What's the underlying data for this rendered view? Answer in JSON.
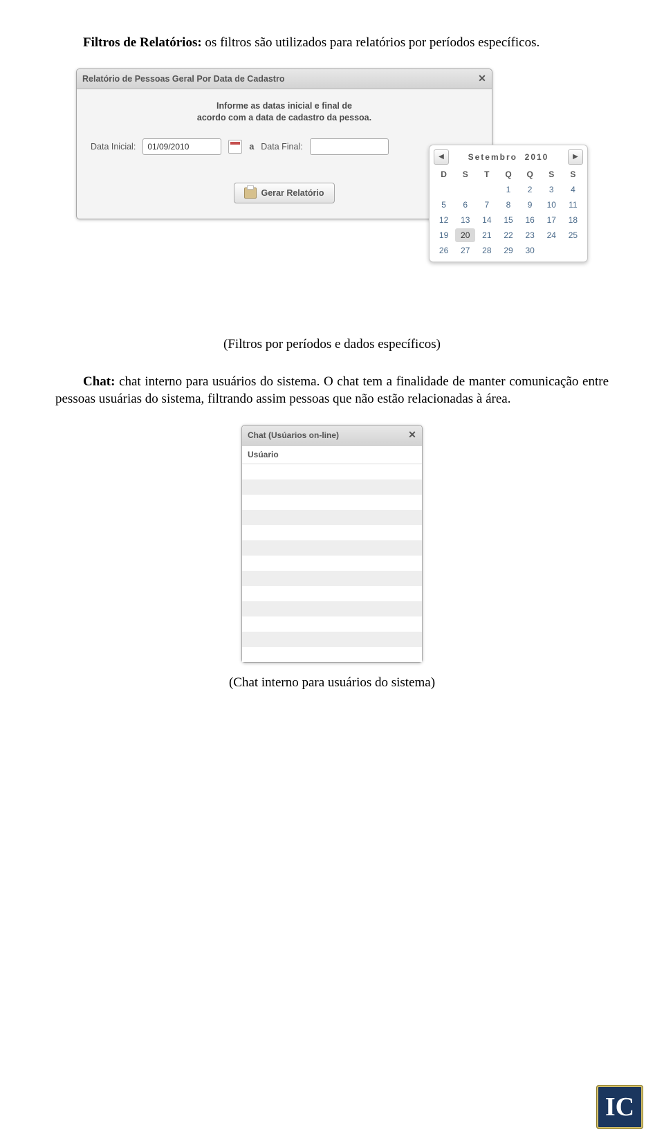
{
  "p1_lead": "Filtros de Relatórios:",
  "p1_rest": " os filtros são utilizados para relatórios por períodos específicos.",
  "cap1": "(Filtros por períodos e dados específicos)",
  "p2_lead": "Chat:",
  "p2_rest": " chat interno para usuários do sistema. O chat tem a finalidade de manter comunicação entre pessoas usuárias do sistema, filtrando assim pessoas que não estão relacionadas à área.",
  "cap2": "(Chat interno para usuários do sistema)",
  "dlg1": {
    "title": "Relatório de Pessoas Geral Por Data de Cadastro",
    "inform1": "Informe as datas inicial e final de",
    "inform2": "acordo com a data de cadastro da pessoa.",
    "label_inicial": "Data Inicial:",
    "value_inicial": "01/09/2010",
    "sep": "a",
    "label_final": "Data Final:",
    "value_final": "",
    "btn": "Gerar Relatório"
  },
  "calendar": {
    "month": "Setembro",
    "year": "2010",
    "dow": [
      "D",
      "S",
      "T",
      "Q",
      "Q",
      "S",
      "S"
    ],
    "leading_blanks": 3,
    "days": 30,
    "today": 20,
    "sel_day": 9
  },
  "dlg2": {
    "title": "Chat (Usúarios on-line)",
    "subhead": "Usúario",
    "rows": 13
  },
  "logo": "IC"
}
